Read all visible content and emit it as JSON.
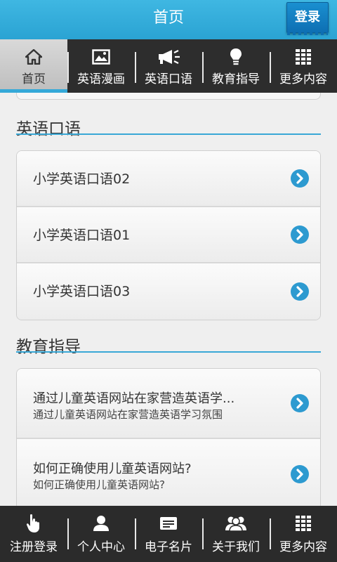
{
  "header": {
    "title": "首页",
    "login_label": "登录"
  },
  "top_nav": [
    {
      "label": "首页",
      "icon": "home-icon",
      "active": true
    },
    {
      "label": "英语漫画",
      "icon": "image-icon"
    },
    {
      "label": "英语口语",
      "icon": "megaphone-icon"
    },
    {
      "label": "教育指导",
      "icon": "lightbulb-icon"
    },
    {
      "label": "更多内容",
      "icon": "grid-icon"
    }
  ],
  "sections": {
    "oral": {
      "title": "英语口语",
      "items": [
        {
          "title": "小学英语口语02"
        },
        {
          "title": "小学英语口语01"
        },
        {
          "title": "小学英语口语03"
        }
      ]
    },
    "guide": {
      "title": "教育指导",
      "items": [
        {
          "title": "通过儿童英语网站在家营造英语学...",
          "subtitle": "通过儿童英语网站在家营造英语学习氛围"
        },
        {
          "title": "如何正确使用儿童英语网站?",
          "subtitle": "如何正确使用儿童英语网站?"
        }
      ]
    }
  },
  "bottom_nav": [
    {
      "label": "注册登录",
      "icon": "hand-pointer-icon"
    },
    {
      "label": "个人中心",
      "icon": "user-icon"
    },
    {
      "label": "电子名片",
      "icon": "card-icon"
    },
    {
      "label": "关于我们",
      "icon": "group-icon"
    },
    {
      "label": "更多内容",
      "icon": "grid-icon"
    }
  ],
  "colors": {
    "accent": "#2aa3d3",
    "nav_bg": "#2d2d2d",
    "chevron": "#2d9ad0"
  }
}
